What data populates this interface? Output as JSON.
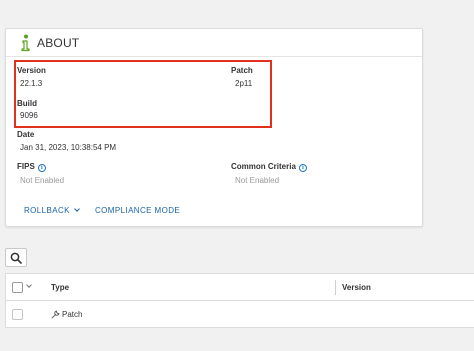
{
  "about": {
    "title": "ABOUT",
    "version": {
      "label": "Version",
      "value": "22.1.3"
    },
    "patch": {
      "label": "Patch",
      "value": "2p11"
    },
    "build": {
      "label": "Build",
      "value": "9096"
    },
    "date": {
      "label": "Date",
      "value": "Jan 31, 2023, 10:38:54 PM"
    },
    "fips": {
      "label": "FIPS",
      "value": "Not Enabled",
      "help_icon": "info-circle-icon"
    },
    "common_criteria": {
      "label": "Common Criteria",
      "value": "Not Enabled",
      "help_icon": "info-circle-icon"
    },
    "actions": {
      "rollback": "ROLLBACK",
      "compliance_mode": "COMPLIANCE MODE"
    },
    "header_icon": "info-icon"
  },
  "search": {
    "icon": "search-icon"
  },
  "table": {
    "columns": [
      "Type",
      "Version"
    ],
    "rows": [
      {
        "type": "Patch",
        "version": "",
        "icon": "wrench-icon"
      }
    ]
  },
  "colors": {
    "accent_green": "#5aa220",
    "link_blue": "#1a63a8",
    "help_blue": "#1a73c9",
    "highlight_red": "#e0301e"
  }
}
